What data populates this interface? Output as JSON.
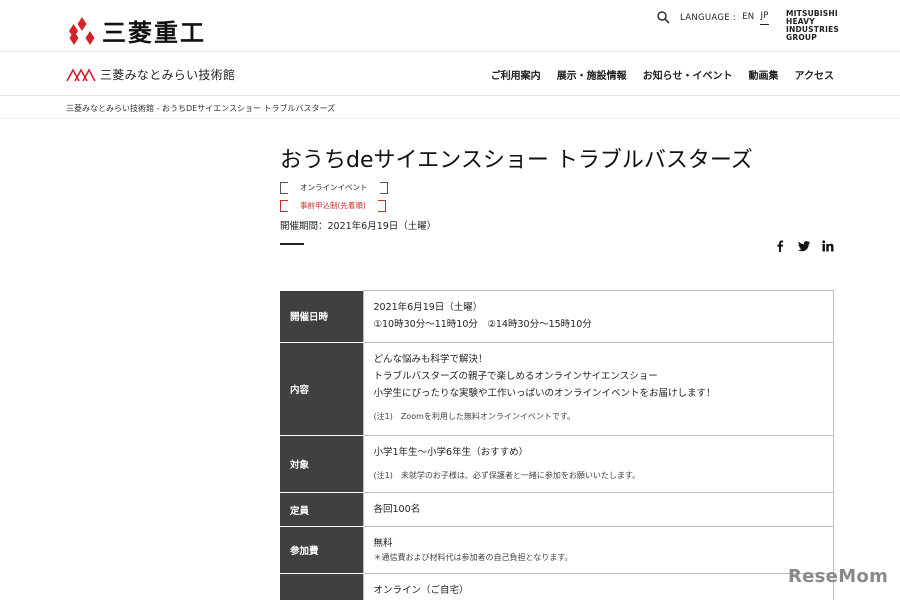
{
  "header": {
    "brand": "三菱重工",
    "language_label": "LANGUAGE :",
    "languages": [
      "EN",
      "JP"
    ],
    "active_language": "JP",
    "group_lines": [
      "MITSUBISHI",
      "HEAVY",
      "INDUSTRIES",
      "GROUP"
    ]
  },
  "subheader": {
    "museum_name": "三菱みなとみらい技術館",
    "nav": [
      "ご利用案内",
      "展示・施設情報",
      "お知らせ・イベント",
      "動画集",
      "アクセス"
    ]
  },
  "breadcrumb": {
    "home": "三菱みなとみらい技術館",
    "sep": " - ",
    "current": "おうちDEサイエンスショー トラブルバスターズ"
  },
  "event": {
    "title": "おうちdeサイエンスショー トラブルバスターズ",
    "tags": [
      "オンラインイベント",
      "事前申込制(先着順)"
    ],
    "period": "開催期間：2021年6月19日（土曜）"
  },
  "share": [
    "facebook-icon",
    "twitter-icon",
    "linkedin-icon"
  ],
  "table": {
    "date_label": "開催日時",
    "date_line1": "2021年6月19日（土曜）",
    "date_line2": "①10時30分～11時10分　②14時30分～15時10分",
    "content_label": "内容",
    "content_line1": "どんな悩みも科学で解決！",
    "content_line2": "トラブルバスターズの親子で楽しめるオンラインサイエンスショー",
    "content_line3": "小学生にぴったりな実験や工作いっぱいのオンラインイベントをお届けします！",
    "content_note": "(注1)　Zoomを利用した無料オンラインイベントです。",
    "target_label": "対象",
    "target_line1": "小学1年生～小学6年生（おすすめ）",
    "target_note": "(注1)　未就学のお子様は、必ず保護者と一緒に参加をお願いいたします。",
    "capacity_label": "定員",
    "capacity_value": "各回100名",
    "fee_label": "参加費",
    "fee_value": "無料",
    "fee_note": "＊通信費および材料代は参加者の自己負担となります。",
    "venue_value": "オンライン（ご自宅）"
  },
  "watermark": "ReseMom",
  "colors": {
    "accent_red": "#d2232a",
    "header_cell": "#404040"
  }
}
